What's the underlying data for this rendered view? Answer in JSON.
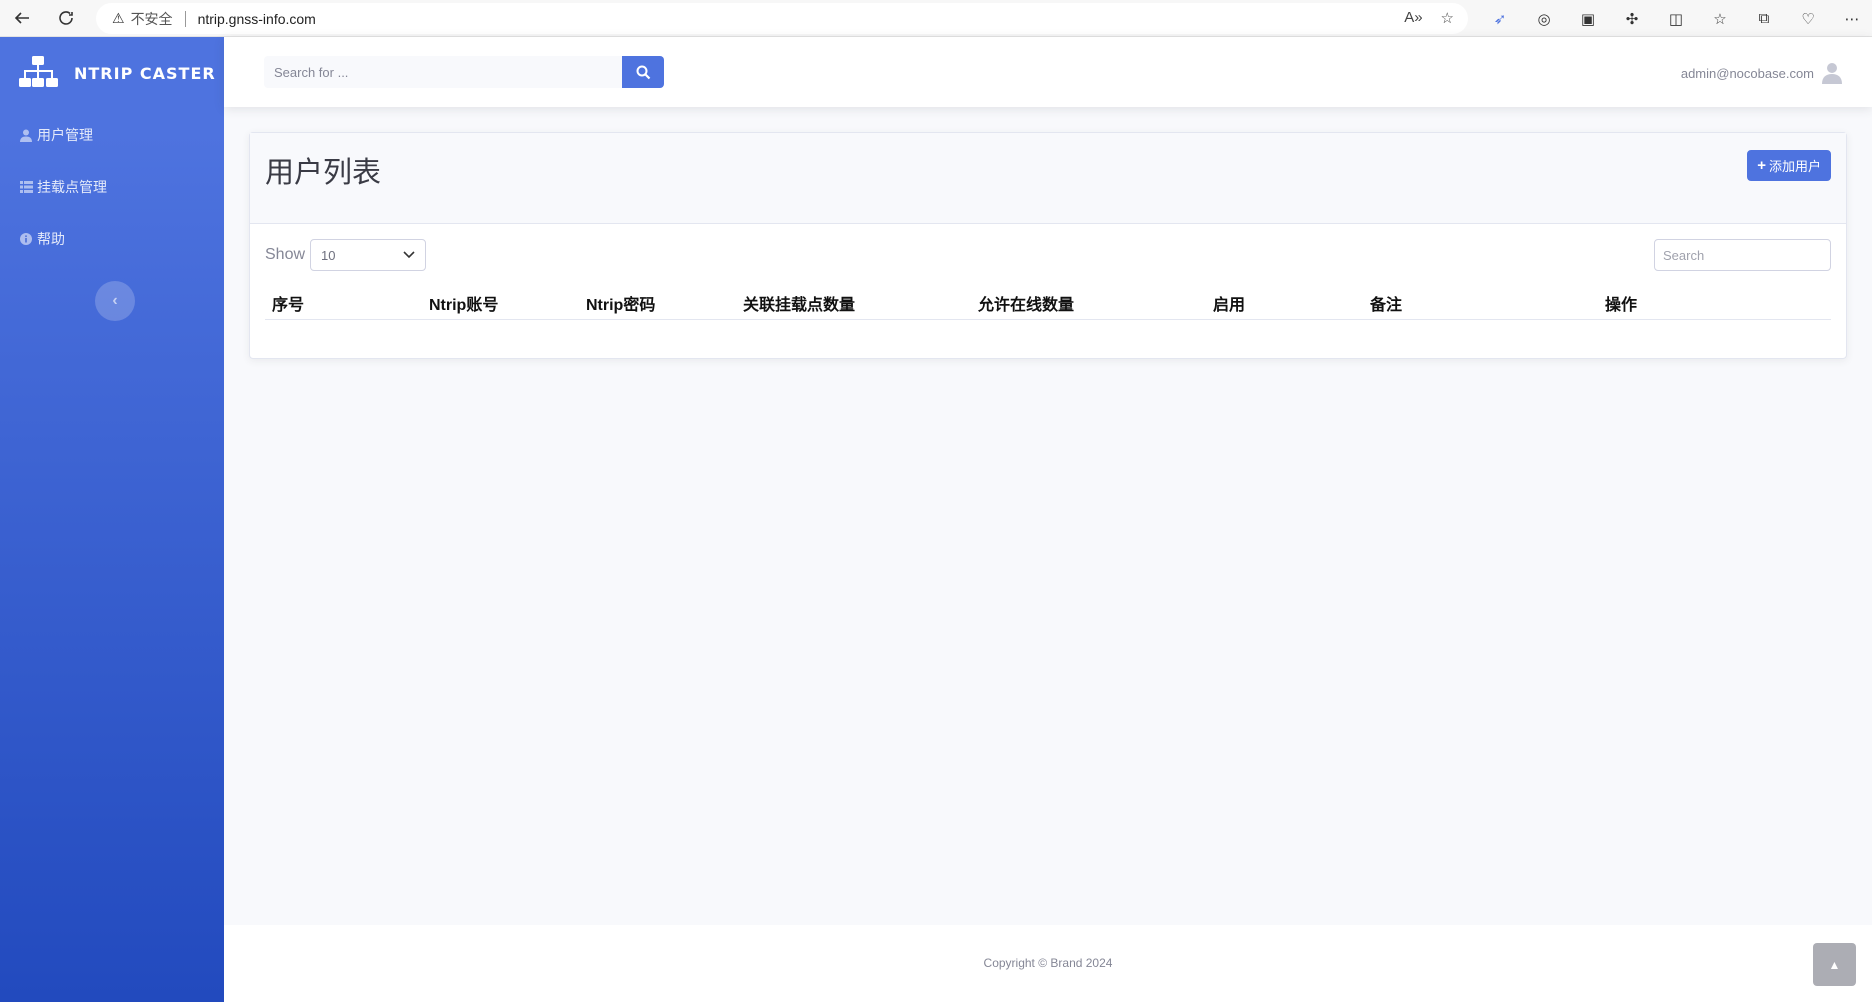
{
  "browser": {
    "security_label": "不安全",
    "url": "ntrip.gnss-info.com"
  },
  "sidebar": {
    "brand": "NTRIP CASTER",
    "items": [
      {
        "label": "用户管理",
        "icon": "user-icon"
      },
      {
        "label": "挂载点管理",
        "icon": "table-icon"
      },
      {
        "label": "帮助",
        "icon": "info-icon"
      }
    ]
  },
  "topbar": {
    "search_placeholder": "Search for ...",
    "user_email": "admin@nocobase.com"
  },
  "card": {
    "title": "用户列表",
    "add_button": "添加用户",
    "show_label": "Show",
    "page_length": "10",
    "filter_placeholder": "Search",
    "columns": [
      "序号",
      "Ntrip账号",
      "Ntrip密码",
      "关联挂载点数量",
      "允许在线数量",
      "启用",
      "备注",
      "操作"
    ]
  },
  "footer": {
    "copyright": "Copyright © Brand 2024"
  },
  "colors": {
    "primary": "#4e73df",
    "sidebar_dark": "#224abe"
  }
}
